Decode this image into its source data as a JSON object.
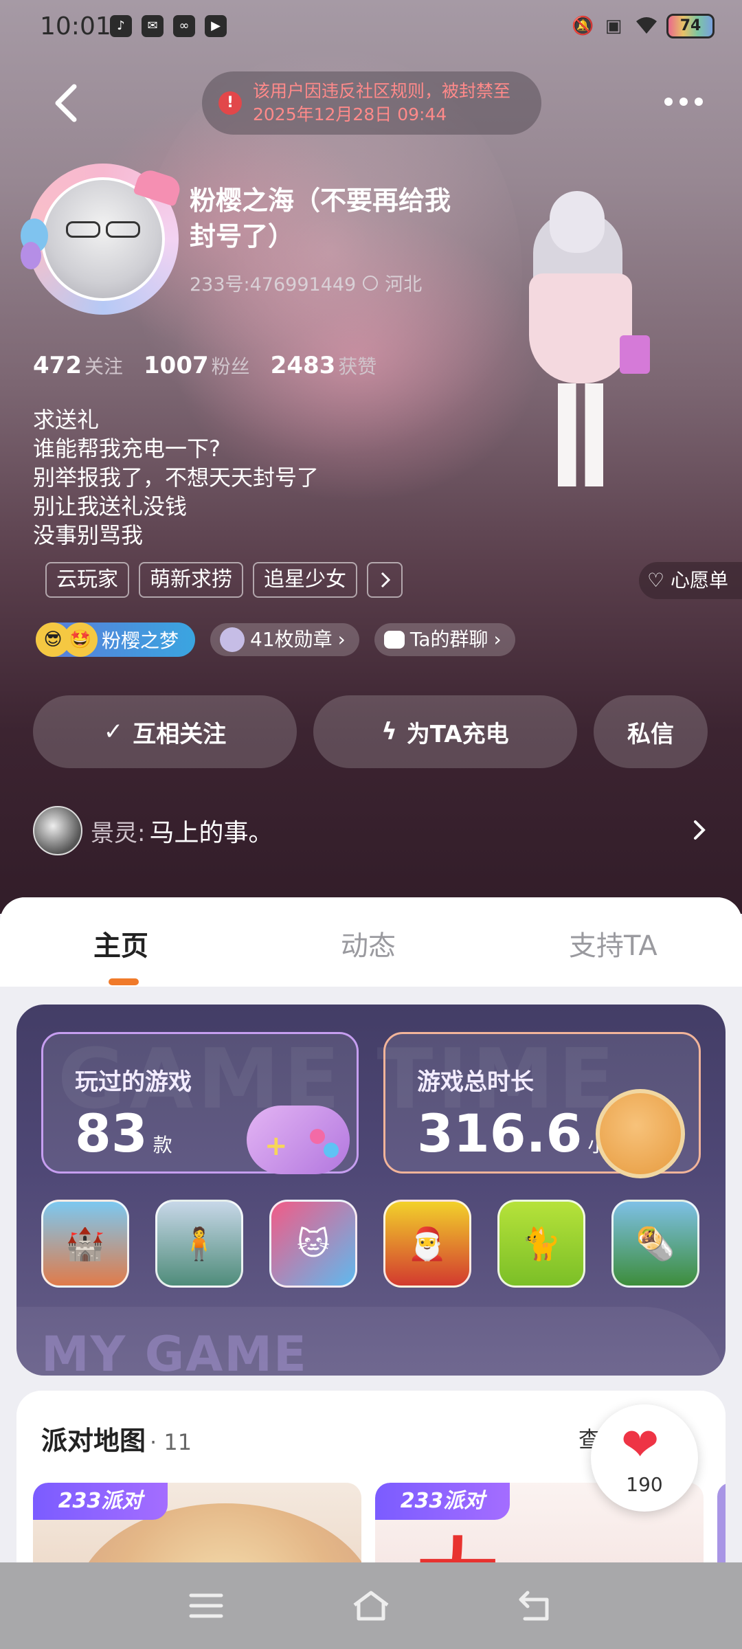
{
  "status_bar": {
    "time": "10:01",
    "battery": "74",
    "app_icons": [
      "tiktok-icon",
      "mail-icon",
      "link-icon",
      "media-icon"
    ]
  },
  "top_bar": {
    "ban_notice": "该用户因违反社区规则，被封禁至\n2025年12月28日 09:44"
  },
  "profile": {
    "nickname": "粉樱之海（不要再给我封号了）",
    "uid": "233号:476991449",
    "location": "河北",
    "stats": [
      {
        "value": "472",
        "label": "关注"
      },
      {
        "value": "1007",
        "label": "粉丝"
      },
      {
        "value": "2483",
        "label": "获赞"
      }
    ],
    "bio": [
      "求送礼",
      "谁能帮我充电一下?",
      "别举报我了，不想天天封号了",
      "别让我送礼没钱",
      "没事别骂我"
    ],
    "tags": [
      "云玩家",
      "萌新求捞",
      "追星少女"
    ],
    "wishlist": "心愿单",
    "fan_badge": "粉樱之梦",
    "medals": "41枚勋章",
    "group_chat": "Ta的群聊"
  },
  "actions": {
    "follow": "互相关注",
    "charge": "为TA充电",
    "message": "私信"
  },
  "comment": {
    "name": "景灵:",
    "text": "马上的事。"
  },
  "tabs": [
    "主页",
    "动态",
    "支持TA"
  ],
  "active_tab": 0,
  "game_card": {
    "watermark_top": "GAME TIME",
    "watermark_bottom": "MY GAME",
    "played_title": "玩过的游戏",
    "played_count": "83",
    "played_unit": "款",
    "time_title": "游戏总时长",
    "time_value": "316.6",
    "time_unit": "小时",
    "games": [
      "town-game",
      "anime-girl-game",
      "talking-angela-2",
      "talking-tom-friends",
      "talking-tom-2",
      "kebab-game"
    ]
  },
  "party": {
    "title": "派对地图",
    "count": "· 11",
    "more": "查",
    "badge": "233派对"
  },
  "likes": "190",
  "colors": {
    "accent": "#f07a2a",
    "ban_red": "#e2474a",
    "heart": "#ee3445"
  }
}
